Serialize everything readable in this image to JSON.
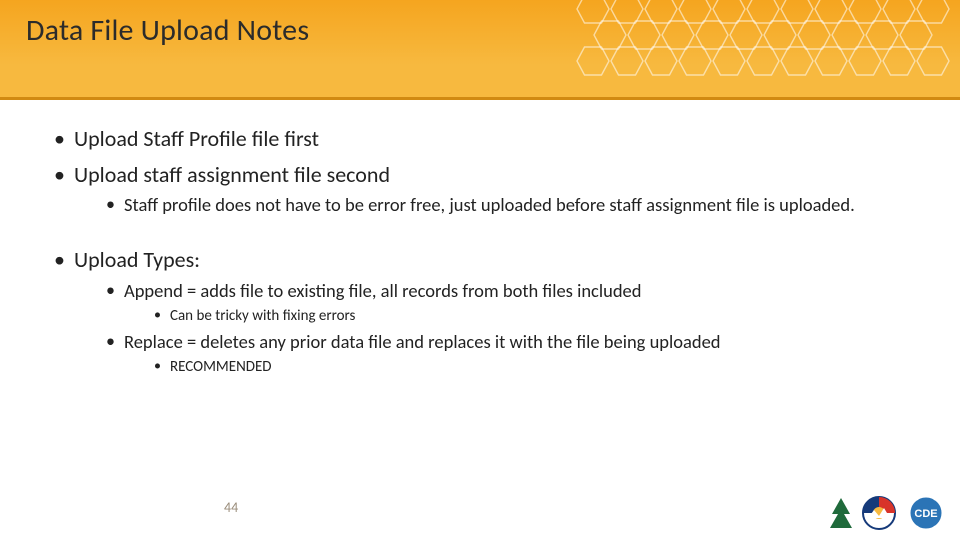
{
  "title": "Data File Upload Notes",
  "page_number": "44",
  "bullets": {
    "b1": "Upload Staff Profile file first",
    "b2": "Upload staff assignment file second",
    "b2_1": "Staff profile does not have to be error free, just uploaded before staff assignment file is uploaded.",
    "b3": "Upload Types:",
    "b3_1": "Append = adds file to existing file, all records from both files included",
    "b3_1_1": "Can be tricky with fixing errors",
    "b3_2": "Replace = deletes any prior data file and replaces it with the file being uploaded",
    "b3_2_1": "RECOMMENDED"
  }
}
